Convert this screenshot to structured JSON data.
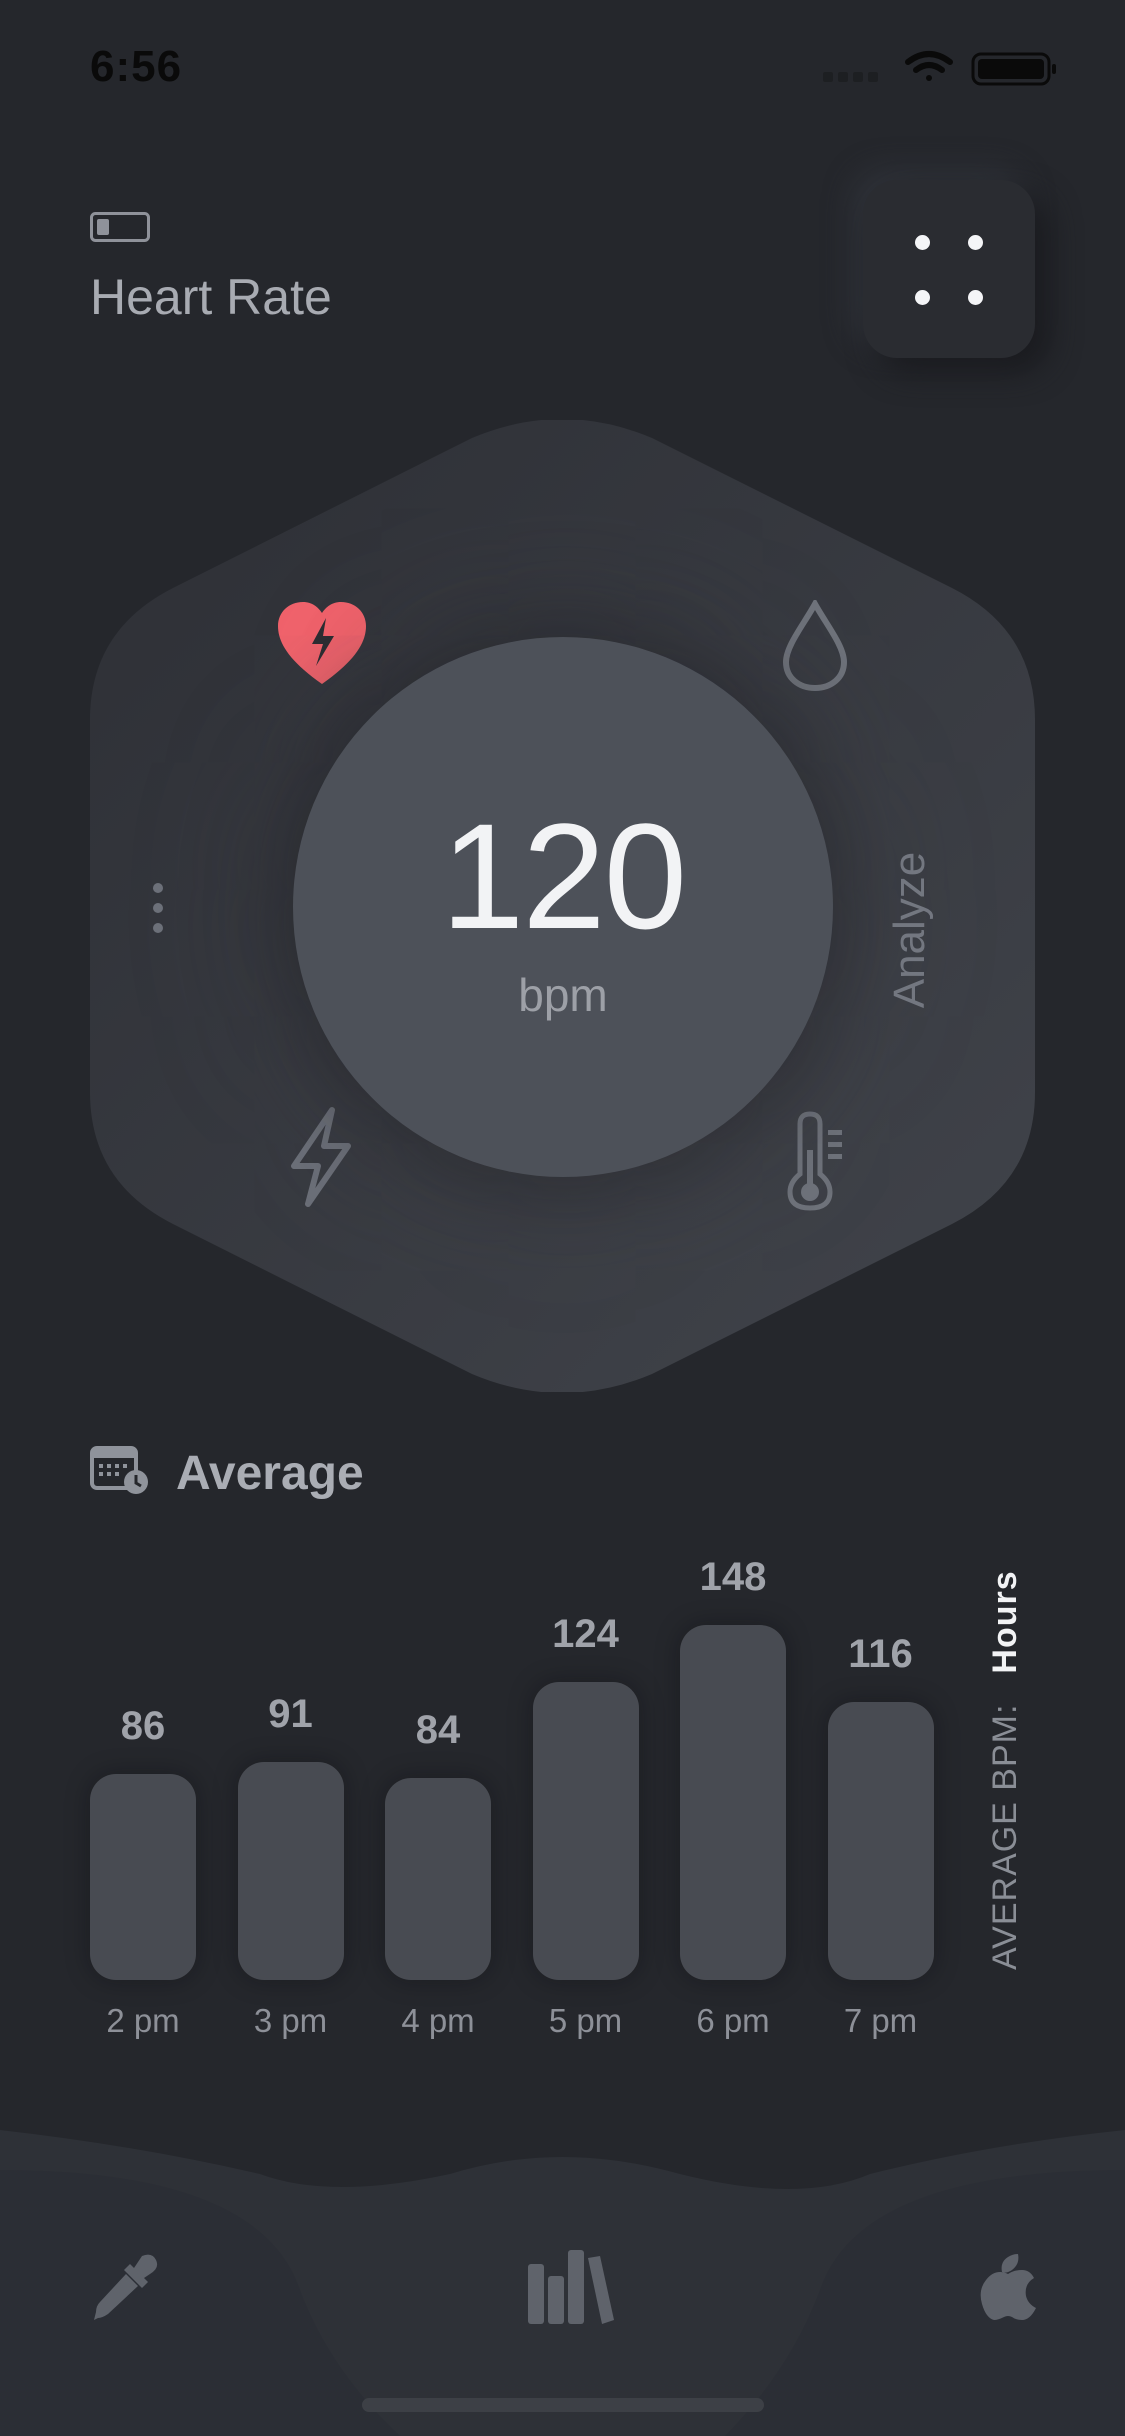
{
  "status_bar": {
    "time": "6:56"
  },
  "header": {
    "title": "Heart Rate"
  },
  "dial": {
    "value": "120",
    "unit": "bpm",
    "side_action": "Analyze"
  },
  "average": {
    "title": "Average",
    "axis_label": "AVERAGE BPM:",
    "period": "Hours"
  },
  "chart_data": {
    "type": "bar",
    "categories": [
      "2 pm",
      "3 pm",
      "4 pm",
      "5 pm",
      "6 pm",
      "7 pm"
    ],
    "values": [
      86,
      91,
      84,
      124,
      148,
      116
    ],
    "ylabel": "AVERAGE BPM:",
    "xlabel": "Hours"
  },
  "colors": {
    "background": "#25272c",
    "accent_heart": "#f0626b",
    "dial": "#4d5159",
    "bar": "#484b52"
  },
  "nav": {
    "items": [
      "eyedropper-icon",
      "library-icon",
      "apple-icon"
    ]
  }
}
